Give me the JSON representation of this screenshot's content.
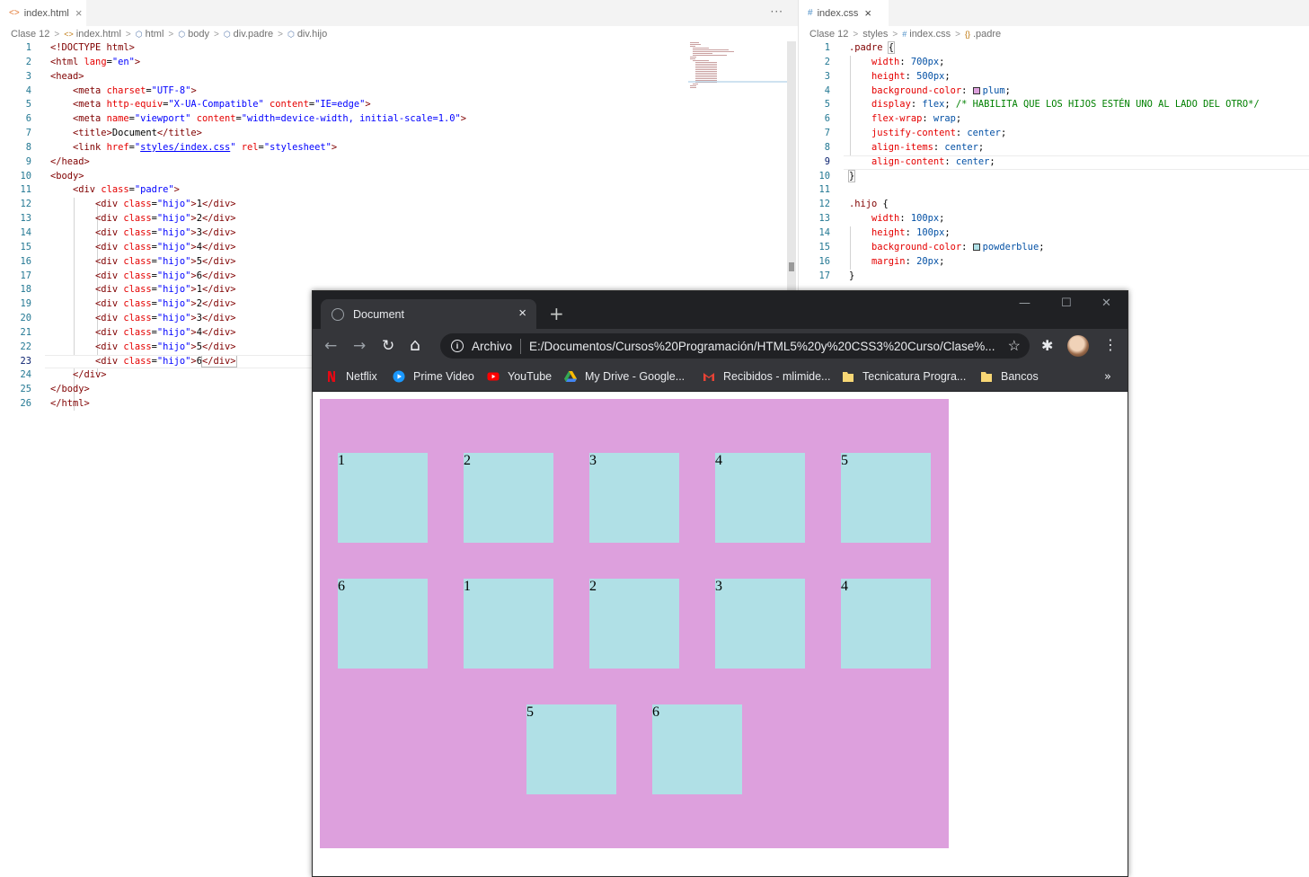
{
  "editor_left": {
    "tab_label": "index.html",
    "tab_icon": "<>",
    "tab_close": "×",
    "tab_actions": "···",
    "breadcrumb": [
      "Clase 12",
      "index.html",
      "html",
      "body",
      "div.padre",
      "div.hijo"
    ],
    "current_line": 23,
    "lines": [
      "1",
      "2",
      "3",
      "4",
      "5",
      "6",
      "7",
      "8",
      "9",
      "10",
      "11",
      "12",
      "13",
      "14",
      "15",
      "16",
      "17",
      "18",
      "19",
      "20",
      "21",
      "22",
      "23",
      "24",
      "25",
      "26"
    ],
    "code": {
      "doctype": "<!DOCTYPE html>",
      "html_open_a": "<html ",
      "html_lang_attr": "lang",
      "html_lang_eq": "=",
      "html_lang_val": "\"en\"",
      "html_open_b": ">",
      "head_open": "<head>",
      "meta1_tag": "<meta ",
      "meta1_attr": "charset",
      "meta1_val": "\"UTF-8\"",
      "meta1_end": ">",
      "meta2_tag": "<meta ",
      "meta2_attr1": "http-equiv",
      "meta2_val1": "\"X-UA-Compatible\"",
      "meta2_attr2": "content",
      "meta2_val2": "\"IE=edge\"",
      "meta2_end": ">",
      "meta3_tag": "<meta ",
      "meta3_attr1": "name",
      "meta3_val1": "\"viewport\"",
      "meta3_attr2": "content",
      "meta3_val2": "\"width=device-width, initial-scale=1.0\"",
      "meta3_end": ">",
      "title_open": "<title>",
      "title_text": "Document",
      "title_close": "</title>",
      "link_tag": "<link ",
      "link_attr1": "href",
      "link_q1": "\"",
      "link_href": "styles/index.css",
      "link_q2": "\"",
      "link_attr2": "rel",
      "link_val2": "\"stylesheet\"",
      "link_end": ">",
      "head_close": "</head>",
      "body_open": "<body>",
      "padre_tag": "<div ",
      "padre_attr": "class",
      "padre_val": "\"padre\"",
      "padre_end": ">",
      "hijo_rows": [
        {
          "open": "<div ",
          "attr": "class",
          "val": "\"hijo\"",
          "gt": ">",
          "text": "1",
          "close": "</div>"
        },
        {
          "open": "<div ",
          "attr": "class",
          "val": "\"hijo\"",
          "gt": ">",
          "text": "2",
          "close": "</div>"
        },
        {
          "open": "<div ",
          "attr": "class",
          "val": "\"hijo\"",
          "gt": ">",
          "text": "3",
          "close": "</div>"
        },
        {
          "open": "<div ",
          "attr": "class",
          "val": "\"hijo\"",
          "gt": ">",
          "text": "4",
          "close": "</div>"
        },
        {
          "open": "<div ",
          "attr": "class",
          "val": "\"hijo\"",
          "gt": ">",
          "text": "5",
          "close": "</div>"
        },
        {
          "open": "<div ",
          "attr": "class",
          "val": "\"hijo\"",
          "gt": ">",
          "text": "6",
          "close": "</div>"
        },
        {
          "open": "<div ",
          "attr": "class",
          "val": "\"hijo\"",
          "gt": ">",
          "text": "1",
          "close": "</div>"
        },
        {
          "open": "<div ",
          "attr": "class",
          "val": "\"hijo\"",
          "gt": ">",
          "text": "2",
          "close": "</div>"
        },
        {
          "open": "<div ",
          "attr": "class",
          "val": "\"hijo\"",
          "gt": ">",
          "text": "3",
          "close": "</div>"
        },
        {
          "open": "<div ",
          "attr": "class",
          "val": "\"hijo\"",
          "gt": ">",
          "text": "4",
          "close": "</div>"
        },
        {
          "open": "<div ",
          "attr": "class",
          "val": "\"hijo\"",
          "gt": ">",
          "text": "5",
          "close": "</div>"
        },
        {
          "open": "<div ",
          "attr": "class",
          "val": "\"hijo\"",
          "gt": ">",
          "text": "6",
          "close": "</div>"
        }
      ],
      "padre_close": "</div>",
      "body_close": "</body>",
      "html_close": "</html>"
    }
  },
  "editor_right": {
    "tab_label": "index.css",
    "tab_icon": "#",
    "tab_close": "×",
    "breadcrumb": [
      "Clase 12",
      "styles",
      "index.css",
      ".padre"
    ],
    "breadcrumb_icons": [
      "",
      "",
      "#",
      "{}"
    ],
    "lines": [
      "1",
      "2",
      "3",
      "4",
      "5",
      "6",
      "7",
      "8",
      "9",
      "10",
      "11",
      "12",
      "13",
      "14",
      "15",
      "16",
      "17"
    ],
    "code": {
      "padre_sel": ".padre ",
      "open_brace": "{",
      "close_brace": "}",
      "padre_props": [
        {
          "prop": "width",
          "val": "700px"
        },
        {
          "prop": "height",
          "val": "500px"
        },
        {
          "prop": "background-color",
          "val": "plum",
          "swatch": "#dda0dd"
        },
        {
          "prop": "display",
          "val": "flex",
          "comment": "/* HABILITA QUE LOS HIJOS ESTÉN UNO AL LADO DEL OTRO*/"
        },
        {
          "prop": "flex-wrap",
          "val": "wrap"
        },
        {
          "prop": "justify-content",
          "val": "center"
        },
        {
          "prop": "align-items",
          "val": "center"
        },
        {
          "prop": "align-content",
          "val": "center"
        }
      ],
      "hijo_sel": ".hijo ",
      "hijo_props": [
        {
          "prop": "width",
          "val": "100px"
        },
        {
          "prop": "height",
          "val": "100px"
        },
        {
          "prop": "background-color",
          "val": "powderblue",
          "swatch": "#b0e0e6"
        },
        {
          "prop": "margin",
          "val": "20px"
        }
      ]
    }
  },
  "browser": {
    "tab_title": "Document",
    "tab_close": "×",
    "new_tab": "+",
    "window_controls": {
      "minimize": "—",
      "maximize": "☐",
      "close": "✕"
    },
    "nav": {
      "back": "←",
      "forward": "→",
      "reload": "↻",
      "home": "⌂"
    },
    "scheme_label": "Archivo",
    "url": "E:/Documentos/Cursos%20Programación/HTML5%20y%20CSS3%20Curso/Clase%...",
    "star": "☆",
    "extensions": "✱",
    "menu": "⋮",
    "bookmarks": [
      {
        "label": "Netflix",
        "icon": "netflix-icon",
        "color": "#e50914"
      },
      {
        "label": "Prime Video",
        "icon": "prime-video-icon",
        "color": "#1a98ff"
      },
      {
        "label": "YouTube",
        "icon": "youtube-icon",
        "color": "#ff0000"
      },
      {
        "label": "My Drive - Google...",
        "icon": "google-drive-icon",
        "color": "#34a853"
      },
      {
        "label": "Recibidos - mlimide...",
        "icon": "gmail-icon",
        "color": "#ea4335"
      },
      {
        "label": "Tecnicatura Progra...",
        "icon": "folder-icon",
        "color": "#f8d775"
      },
      {
        "label": "Bancos",
        "icon": "folder-icon",
        "color": "#f8d775"
      }
    ],
    "bookmarks_more": "»",
    "page": {
      "padre_color": "#dda0dd",
      "hijo_color": "#b0e0e6",
      "boxes": [
        "1",
        "2",
        "3",
        "4",
        "5",
        "6",
        "1",
        "2",
        "3",
        "4",
        "5",
        "6"
      ]
    }
  }
}
